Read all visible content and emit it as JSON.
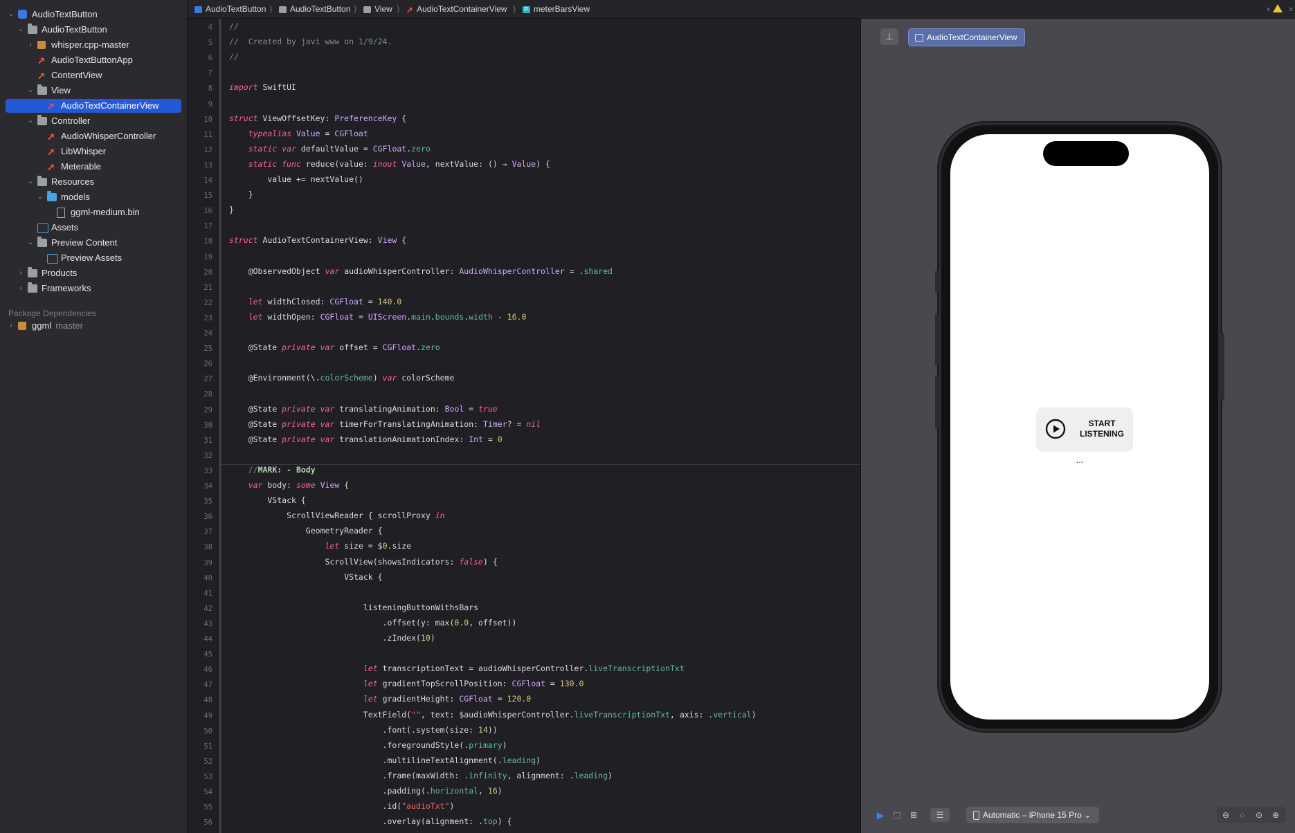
{
  "breadcrumb": [
    "AudioTextButton",
    "AudioTextButton",
    "View",
    "AudioTextContainerView",
    "meterBarsView"
  ],
  "sidebar": {
    "items": [
      {
        "label": "AudioTextButton",
        "icon": "app-icon"
      },
      {
        "label": "AudioTextButton",
        "icon": "folder-icon"
      },
      {
        "label": "whisper.cpp-master",
        "icon": "package-icon"
      },
      {
        "label": "AudioTextButtonApp",
        "icon": "swift-file-icon"
      },
      {
        "label": "ContentView",
        "icon": "swift-file-icon"
      },
      {
        "label": "View",
        "icon": "folder-icon"
      },
      {
        "label": "AudioTextContainerView",
        "icon": "swift-file-icon"
      },
      {
        "label": "Controller",
        "icon": "folder-icon"
      },
      {
        "label": "AudioWhisperController",
        "icon": "swift-file-icon"
      },
      {
        "label": "LibWhisper",
        "icon": "swift-file-icon"
      },
      {
        "label": "Meterable",
        "icon": "swift-file-icon"
      },
      {
        "label": "Resources",
        "icon": "folder-icon"
      },
      {
        "label": "models",
        "icon": "blue-folder-icon"
      },
      {
        "label": "ggml-medium.bin",
        "icon": "file-icon"
      },
      {
        "label": "Assets",
        "icon": "assets-icon"
      },
      {
        "label": "Preview Content",
        "icon": "folder-icon"
      },
      {
        "label": "Preview Assets",
        "icon": "assets-icon"
      },
      {
        "label": "Products",
        "icon": "folder-icon"
      },
      {
        "label": "Frameworks",
        "icon": "folder-icon"
      }
    ],
    "package_heading": "Package Dependencies",
    "package": {
      "name": "ggml",
      "branch": "master"
    }
  },
  "editor": {
    "line_numbers": [
      "4",
      "5",
      "6",
      "7",
      "8",
      "9",
      "10",
      "11",
      "12",
      "13",
      "14",
      "15",
      "16",
      "17",
      "18",
      "19",
      "20",
      "21",
      "22",
      "23",
      "24",
      "25",
      "26",
      "27",
      "28",
      "29",
      "30",
      "31",
      "32",
      "33",
      "34",
      "35",
      "36",
      "37",
      "38",
      "39",
      "40",
      "41",
      "42",
      "43",
      "44",
      "45",
      "46",
      "47",
      "48",
      "49",
      "50",
      "51",
      "52",
      "53",
      "54",
      "55",
      "56"
    ],
    "code_lines": [
      "//",
      "//  Created by javi www on 1/9/24.",
      "//",
      "",
      "import SwiftUI",
      "",
      "struct ViewOffsetKey: PreferenceKey {",
      "    typealias Value = CGFloat",
      "    static var defaultValue = CGFloat.zero",
      "    static func reduce(value: inout Value, nextValue: () → Value) {",
      "        value += nextValue()",
      "    }",
      "}",
      "",
      "struct AudioTextContainerView: View {",
      "",
      "    @ObservedObject var audioWhisperController: AudioWhisperController = .shared",
      "",
      "    let widthClosed: CGFloat = 140.0",
      "    let widthOpen: CGFloat = UIScreen.main.bounds.width - 16.0",
      "",
      "    @State private var offset = CGFloat.zero",
      "",
      "    @Environment(\\.colorScheme) var colorScheme",
      "",
      "    @State private var translatingAnimation: Bool = true",
      "    @State private var timerForTranslatingAnimation: Timer? = nil",
      "    @State private var translationAnimationIndex: Int = 0",
      "",
      "    //MARK: - Body",
      "    var body: some View {",
      "        VStack {",
      "            ScrollViewReader { scrollProxy in",
      "                GeometryReader {",
      "                    let size = $0.size",
      "                    ScrollView(showsIndicators: false) {",
      "                        VStack {",
      "",
      "                            listeningButtonWithsBars",
      "                                .offset(y: max(0.0, offset))",
      "                                .zIndex(10)",
      "",
      "                            let transcriptionText = audioWhisperController.liveTranscriptionTxt",
      "                            let gradientTopScrollPosition: CGFloat = 130.0",
      "                            let gradientHeight: CGFloat = 120.0",
      "                            TextField(\"\", text: $audioWhisperController.liveTranscriptionTxt, axis: .vertical)",
      "                                .font(.system(size: 14))",
      "                                .foregroundStyle(.primary)",
      "                                .multilineTextAlignment(.leading)",
      "                                .frame(maxWidth: .infinity, alignment: .leading)",
      "                                .padding(.horizontal, 16)",
      "                                .id(\"audioTxt\")",
      "                                .overlay(alignment: .top) {"
    ]
  },
  "preview": {
    "tab_label": "AudioTextContainerView",
    "button_line1": "START",
    "button_line2": "LISTENING",
    "ellipsis": "...",
    "device": "Automatic – iPhone 15 Pro ⌄"
  }
}
